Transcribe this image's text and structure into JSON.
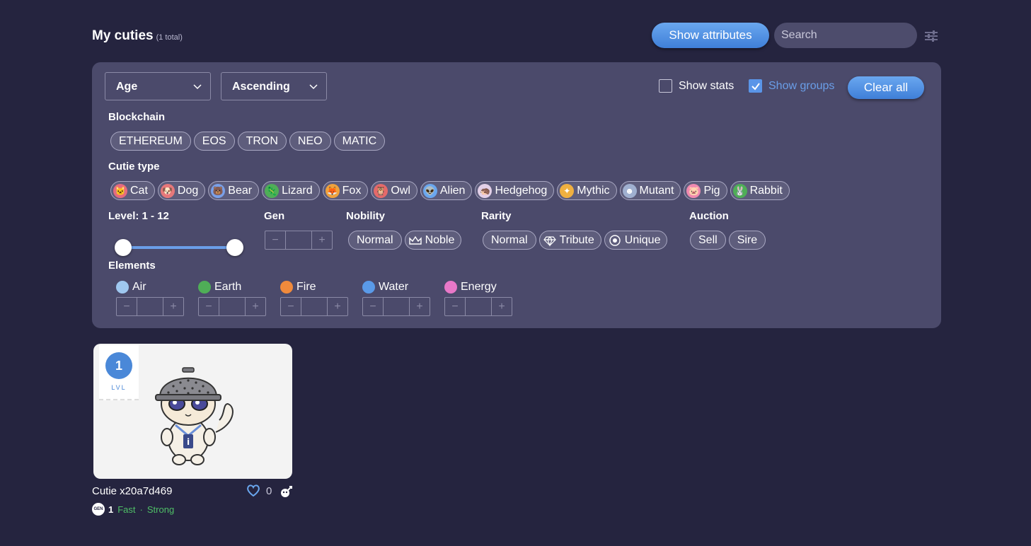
{
  "header": {
    "title": "My cuties",
    "count": "(1 total)",
    "show_attributes": "Show attributes",
    "search_placeholder": "Search"
  },
  "filters": {
    "sort_field": "Age",
    "sort_order": "Ascending",
    "show_stats": "Show stats",
    "show_groups": "Show groups",
    "clear_all": "Clear all",
    "blockchain_label": "Blockchain",
    "blockchains": [
      "ETHEREUM",
      "EOS",
      "TRON",
      "NEO",
      "MATIC"
    ],
    "cutie_type_label": "Cutie type",
    "cutie_types": [
      {
        "label": "Cat",
        "icon": "cat-icon",
        "color": "#e66a7e"
      },
      {
        "label": "Dog",
        "icon": "dog-icon",
        "color": "#e6787a"
      },
      {
        "label": "Bear",
        "icon": "bear-icon",
        "color": "#7aa0e8"
      },
      {
        "label": "Lizard",
        "icon": "lizard-icon",
        "color": "#4fae57"
      },
      {
        "label": "Fox",
        "icon": "fox-icon",
        "color": "#f0a23c"
      },
      {
        "label": "Owl",
        "icon": "owl-icon",
        "color": "#e46a6a"
      },
      {
        "label": "Alien",
        "icon": "alien-icon",
        "color": "#6aa7ef"
      },
      {
        "label": "Hedgehog",
        "icon": "hedgehog-icon",
        "color": "#e3d0e8"
      },
      {
        "label": "Mythic",
        "icon": "mythic-icon",
        "color": "#f0b040"
      },
      {
        "label": "Mutant",
        "icon": "mutant-icon",
        "color": "#a0b0d0"
      },
      {
        "label": "Pig",
        "icon": "pig-icon",
        "color": "#f08ab0"
      },
      {
        "label": "Rabbit",
        "icon": "rabbit-icon",
        "color": "#4fae57"
      }
    ],
    "level_label": "Level: 1 - 12",
    "level_range": [
      1,
      12
    ],
    "gen_label": "Gen",
    "nobility_label": "Nobility",
    "nobility": [
      "Normal",
      "Noble"
    ],
    "rarity_label": "Rarity",
    "rarity": [
      "Normal",
      "Tribute",
      "Unique"
    ],
    "auction_label": "Auction",
    "auction": [
      "Sell",
      "Sire"
    ],
    "elements_label": "Elements",
    "elements": [
      {
        "label": "Air",
        "icon": "air-icon",
        "color": "#9fc8f0"
      },
      {
        "label": "Earth",
        "icon": "earth-icon",
        "color": "#4fae57"
      },
      {
        "label": "Fire",
        "icon": "fire-icon",
        "color": "#f08a3c"
      },
      {
        "label": "Water",
        "icon": "water-icon",
        "color": "#5a9ae8"
      },
      {
        "label": "Energy",
        "icon": "energy-icon",
        "color": "#e878c8"
      }
    ]
  },
  "cutie": {
    "level": "1",
    "level_text": "LVL",
    "name": "Cutie x20a7d469",
    "likes": "0",
    "gen": "1",
    "gen_badge": "GEN",
    "trait1": "Fast",
    "separator": "·",
    "trait2": "Strong"
  },
  "colors": {
    "background": "#25243f",
    "panel": "#4b4a6b",
    "accent": "#5a95e8",
    "green": "#4fbf67"
  }
}
